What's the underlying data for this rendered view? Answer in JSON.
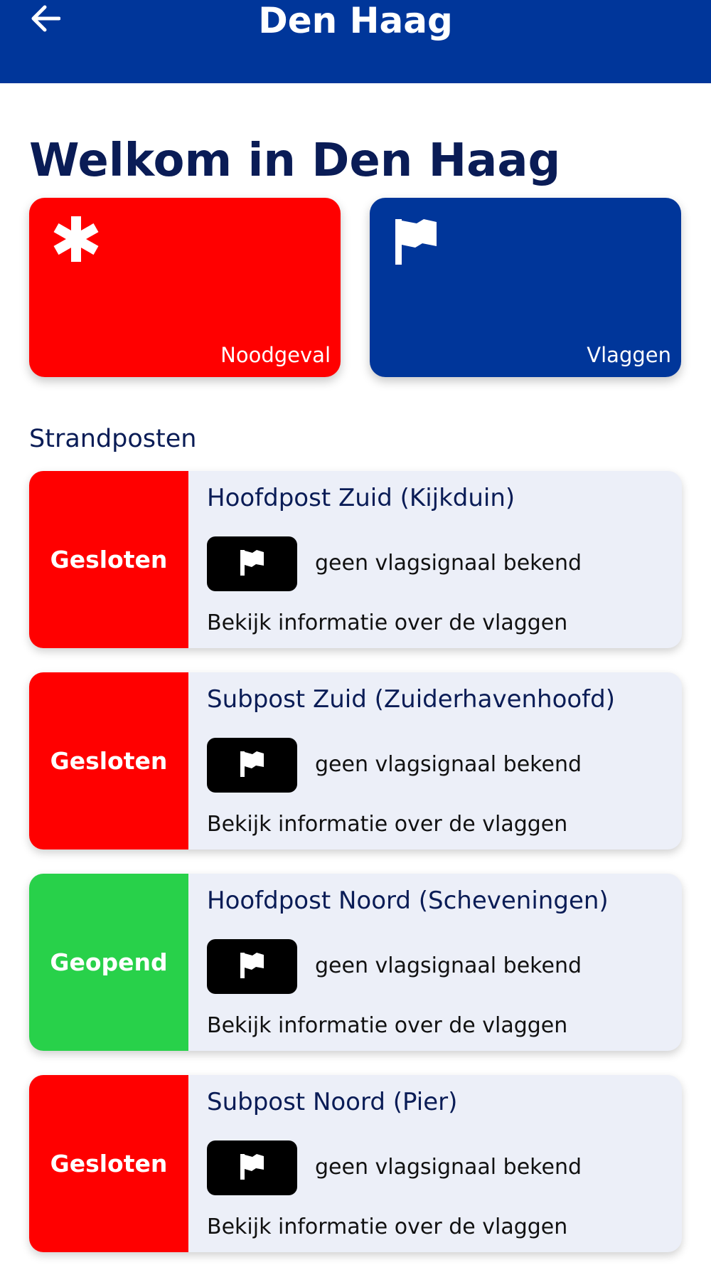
{
  "header": {
    "title": "Den Haag",
    "back_icon": "arrow-left-icon",
    "background": "#00369a"
  },
  "welcome_title": "Welkom in Den Haag",
  "tiles": {
    "emergency": {
      "label": "Noodgeval",
      "icon": "asterisk-icon",
      "color": "#ff0000"
    },
    "flags": {
      "label": "Vlaggen",
      "icon": "flag-icon",
      "color": "#00369a"
    }
  },
  "section_title": "Strandposten",
  "posts": [
    {
      "name": "Hoofdpost Zuid (Kijkduin)",
      "status": "Gesloten",
      "status_color": "#ff0000",
      "flag_text": "geen vlagsignaal bekend",
      "info_link": "Bekijk informatie over de vlaggen"
    },
    {
      "name": "Subpost Zuid (Zuiderhavenhoofd)",
      "status": "Gesloten",
      "status_color": "#ff0000",
      "flag_text": "geen vlagsignaal bekend",
      "info_link": "Bekijk informatie over de vlaggen"
    },
    {
      "name": "Hoofdpost Noord (Scheveningen)",
      "status": "Geopend",
      "status_color": "#28d14a",
      "flag_text": "geen vlagsignaal bekend",
      "info_link": "Bekijk informatie over de vlaggen"
    },
    {
      "name": "Subpost Noord (Pier)",
      "status": "Gesloten",
      "status_color": "#ff0000",
      "flag_text": "geen vlagsignaal bekend",
      "info_link": "Bekijk informatie over de vlaggen"
    }
  ]
}
